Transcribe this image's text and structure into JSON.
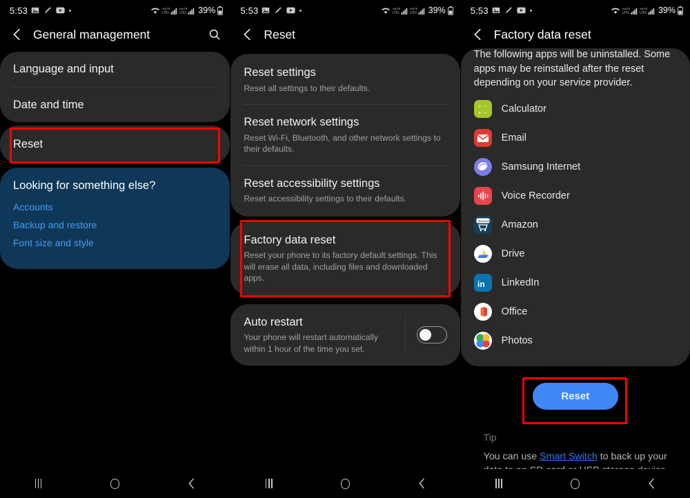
{
  "status_bar": {
    "time": "5:53",
    "left_icons": [
      "image-icon",
      "pencil-icon",
      "youtube-icon",
      "dot-icon"
    ],
    "right_icons": [
      "wifi-icon",
      "volte1-signal-icon",
      "volte2-signal-icon"
    ],
    "battery": "39%",
    "battery_icon": "battery-icon"
  },
  "nav_bar": {
    "recents_label": "Recents",
    "home_label": "Home",
    "back_label": "Back"
  },
  "colors": {
    "highlight": "#ff0000",
    "accent_blue": "#3f87f5",
    "link_blue": "#4a9bf0",
    "tip_link": "#2f7fe8",
    "card_bg": "#2a2a2a",
    "blue_card_bg": "#0e3758",
    "screen_bg": "#000000"
  },
  "panel1": {
    "title": "General management",
    "back_icon": "back-chevron-icon",
    "search_icon": "search-icon",
    "items": [
      {
        "label": "Language and input",
        "highlighted": false
      },
      {
        "label": "Date and time",
        "highlighted": false
      }
    ],
    "highlighted_item": {
      "label": "Reset",
      "highlighted": true
    },
    "suggestion_card": {
      "title": "Looking for something else?",
      "links": [
        "Accounts",
        "Backup and restore",
        "Font size and style"
      ]
    }
  },
  "panel2": {
    "title": "Reset",
    "back_icon": "back-chevron-icon",
    "items": [
      {
        "title": "Reset settings",
        "subtitle": "Reset all settings to their defaults."
      },
      {
        "title": "Reset network settings",
        "subtitle": "Reset Wi-Fi, Bluetooth, and other network settings to their defaults."
      },
      {
        "title": "Reset accessibility settings",
        "subtitle": "Reset accessibility settings to their defaults."
      }
    ],
    "highlighted_item": {
      "title": "Factory data reset",
      "subtitle": "Reset your phone to its factory default settings. This will erase all data, including files and downloaded apps."
    },
    "auto_restart": {
      "title": "Auto restart",
      "subtitle": "Your phone will restart automatically within 1 hour of the time you set.",
      "toggle_state": "off"
    }
  },
  "panel3": {
    "title": "Factory data reset",
    "back_icon": "back-chevron-icon",
    "intro": "The following apps will be uninstalled. Some apps may be reinstalled after the reset depending on your service provider.",
    "apps": [
      {
        "name": "Calculator",
        "icon": "calculator-app-icon"
      },
      {
        "name": "Email",
        "icon": "email-app-icon"
      },
      {
        "name": "Samsung Internet",
        "icon": "samsung-internet-app-icon"
      },
      {
        "name": "Voice Recorder",
        "icon": "voice-recorder-app-icon"
      },
      {
        "name": "Amazon",
        "icon": "amazon-app-icon"
      },
      {
        "name": "Drive",
        "icon": "google-drive-app-icon"
      },
      {
        "name": "LinkedIn",
        "icon": "linkedin-app-icon"
      },
      {
        "name": "Office",
        "icon": "microsoft-office-app-icon"
      },
      {
        "name": "Photos",
        "icon": "google-photos-app-icon"
      }
    ],
    "reset_button": "Reset",
    "tip": {
      "title": "Tip",
      "text_before": "You can use ",
      "link": "Smart Switch",
      "text_after": " to back up your data to an SD card or USB storage device before resetting your phone."
    }
  }
}
